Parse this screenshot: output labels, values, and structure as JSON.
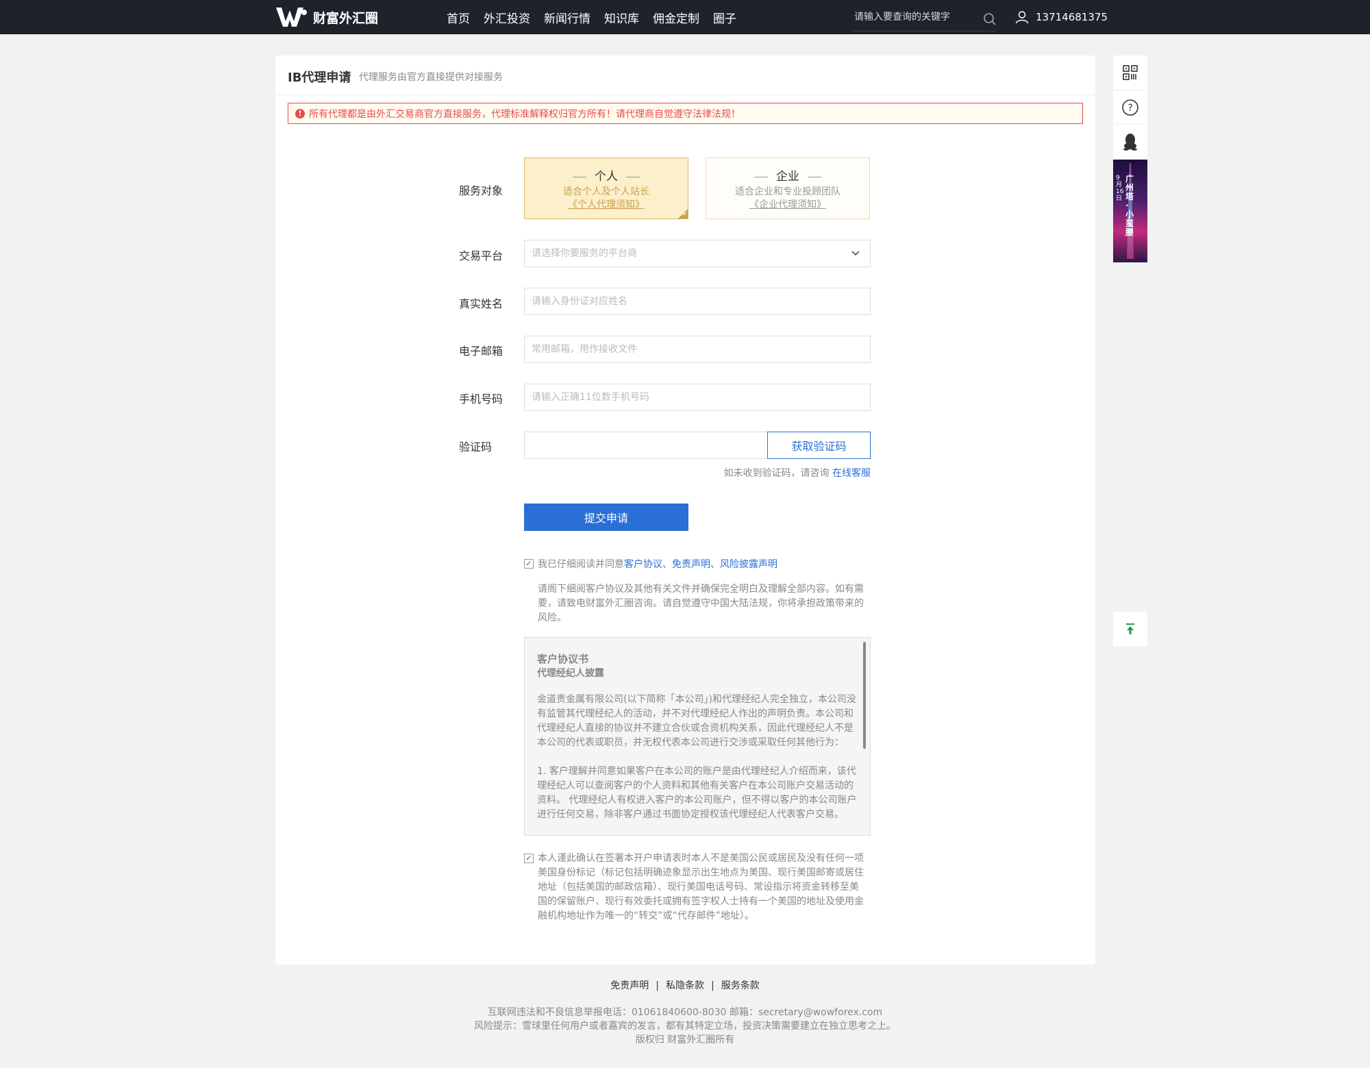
{
  "header": {
    "brand": "财富外汇圈",
    "nav": [
      "首页",
      "外汇投资",
      "新闻行情",
      "知识库",
      "佣金定制",
      "圈子"
    ],
    "search_placeholder": "请输入要查询的关键字",
    "user_phone": "13714681375"
  },
  "page": {
    "title": "IB代理申请",
    "subtitle": "代理服务由官方直接提供对接服务",
    "alert": "所有代理都是由外汇交易商官方直接服务，代理标准解释权归官方所有！请代理商自觉遵守法律法规！"
  },
  "form": {
    "service_label": "服务对象",
    "options": [
      {
        "title": "个人",
        "desc": "适合个人及个人站长",
        "link": "《个人代理须知》",
        "selected": true
      },
      {
        "title": "企业",
        "desc": "适合企业和专业投顾团队",
        "link": "《企业代理须知》",
        "selected": false
      }
    ],
    "platform_label": "交易平台",
    "platform_placeholder": "请选择你要服务的平台商",
    "name_label": "真实姓名",
    "name_placeholder": "请输入身份证对应姓名",
    "email_label": "电子邮箱",
    "email_placeholder": "常用邮箱，用作接收文件",
    "phone_label": "手机号码",
    "phone_placeholder": "请输入正确11位数手机号码",
    "code_label": "验证码",
    "code_button": "获取验证码",
    "code_hint": "如未收到验证码，请咨询",
    "code_hint_link": "在线客服",
    "submit": "提交申请",
    "agree_prefix": "我已仔细阅读并同意",
    "agree_links": [
      "客户协议",
      "免责声明",
      "风险披露声明"
    ],
    "agree_sep": "、",
    "agree_checked": true,
    "note": "请阁下细阅客户协议及其他有关文件并确保完全明白及理解全部内容。如有需要，请致电财富外汇圈咨询。请自觉遵守中国大陆法规，你将承担政策带来的风险。",
    "terms": {
      "title": "客户协议书",
      "subtitle": "代理经纪人披露",
      "p1": "金道贵金属有限公司(以下简称「本公司」)和代理经纪人完全独立，本公司没有监管其代理经纪人的活动，并不对代理经纪人作出的声明负责。本公司和代理经纪人直接的协议并不建立合伙或合资机构关系，因此代理经纪人不是本公司的代表或职员，并无权代表本公司进行交涉或采取任何其他行为：",
      "p2": "1. 客户理解并同意如果客户在本公司的账户是由代理经纪人介绍而来，该代理经纪人可以查阅客户的个人资料和其他有关客户在本公司账户交易活动的资料。 代理经纪人有权进入客户的本公司账户，但不得以客户的本公司账户进行任何交易，除非客户通过书面协定授权该代理经纪人代表客户交易。"
    },
    "confirm_checked": true,
    "confirm": "本人谨此确认在签署本开户申请表时本人不是美国公民或居民及没有任何一项美国身份标记（标记包括明确迹象显示出生地点为美国、现行美国邮寄或居住地址（包括美国的邮政信箱）、现行美国电话号码、常设指示将资金转移至美国的保留账户、现行有效委托或拥有签字权人士持有一个美国的地址及使用金融机构地址作为唯一的“转交”或“代存邮件”地址）。"
  },
  "side": {
    "banner_date": "9月16日",
    "banner_text": "广州塔·小蛮腰"
  },
  "footer": {
    "links": [
      "免责声明",
      "私隐条款",
      "服务条款"
    ],
    "line1": "互联网违法和不良信息举报电话：01061840600-8030 邮箱：secretary@wowforex.com",
    "line2": "风险提示：雪球里任何用户或者嘉宾的发言，都有其特定立场，投资决策需要建立在独立思考之上。",
    "line3": "版权归 财富外汇圈所有"
  },
  "colors": {
    "accent": "#2a6fd6",
    "alert": "#e84b4b",
    "gold": "#c9a049",
    "topbar": "#1e232b"
  }
}
